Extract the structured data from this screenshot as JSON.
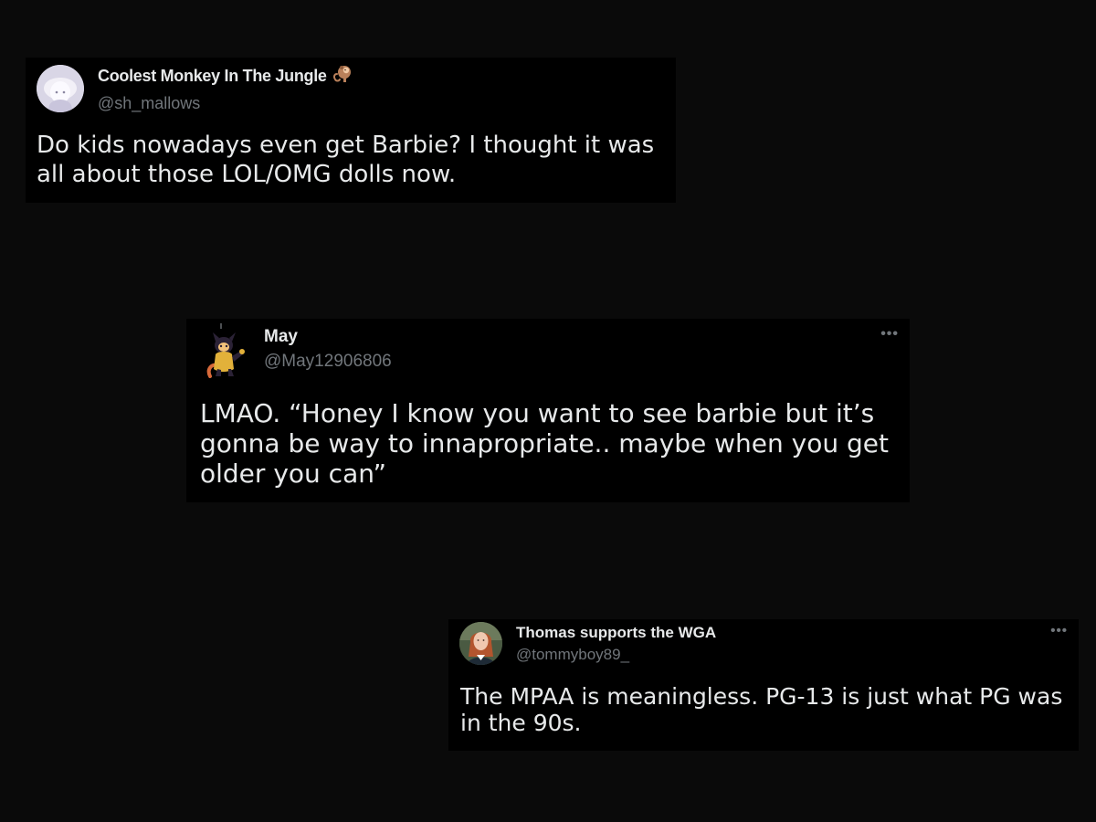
{
  "tweets": [
    {
      "display_name": "Coolest Monkey In The Jungle",
      "name_emoji": "monkey-icon",
      "handle": "@sh_mallows",
      "text": "Do kids nowadays even get Barbie? I thought it was\nall about those LOL/OMG dolls now."
    },
    {
      "display_name": "May",
      "handle": "@May12906806",
      "more_label": "•••",
      "text": "LMAO. “Honey I know you want to see barbie but it’s\ngonna be way to innapropriate.. maybe when you get\nolder you can”"
    },
    {
      "display_name": "Thomas supports the WGA",
      "handle": "@tommyboy89_",
      "more_label": "•••",
      "text": "The MPAA is meaningless. PG-13 is just what PG was\nin the 90s."
    }
  ],
  "colors": {
    "background": "#0a0a0a",
    "card": "#000000",
    "primary_text": "#e7e9ea",
    "secondary_text": "#71767b"
  }
}
